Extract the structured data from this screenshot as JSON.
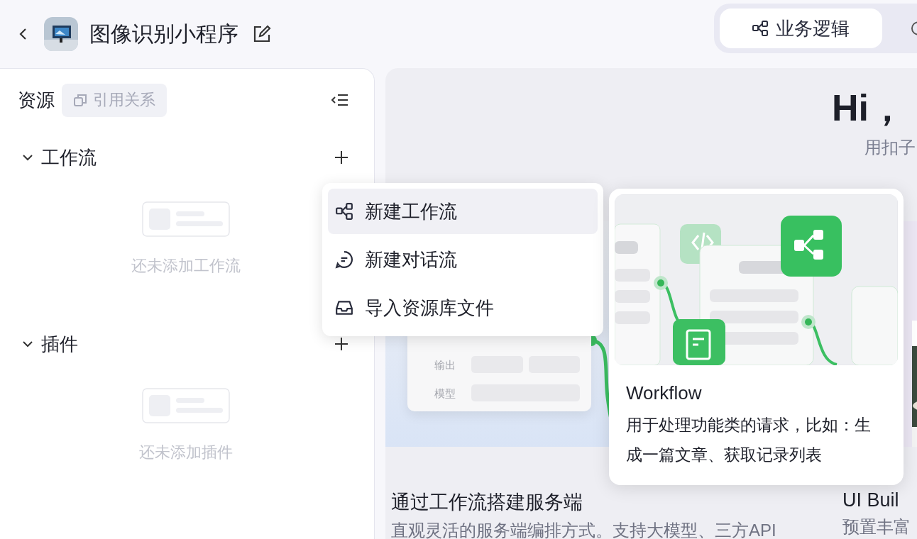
{
  "header": {
    "title": "图像识别小程序",
    "tabs": [
      {
        "label": "业务逻辑",
        "selected": true
      }
    ]
  },
  "resources": {
    "title": "资源",
    "reference_button": {
      "label": "引用关系",
      "disabled": true
    },
    "sections": [
      {
        "title": "工作流",
        "expanded": true,
        "empty_text": "还未添加工作流"
      },
      {
        "title": "插件",
        "expanded": true,
        "empty_text": "还未添加插件"
      }
    ]
  },
  "main": {
    "greeting": "Hi，",
    "subtitle": "用扣子",
    "cards": [
      {
        "title": "通过工作流搭建服务端",
        "description": "直观灵活的服务端编排方式。支持大模型、三方API",
        "labels": [
          "输出",
          "模型"
        ]
      },
      {
        "title": "UI Buil",
        "description": "预置丰富"
      }
    ]
  },
  "menu": {
    "items": [
      {
        "kind": "workflow",
        "label": "新建工作流",
        "selected": true
      },
      {
        "kind": "chat",
        "label": "新建对话流",
        "selected": false
      },
      {
        "kind": "import",
        "label": "导入资源库文件",
        "selected": false
      }
    ]
  },
  "preview": {
    "title": "Workflow",
    "description": "用于处理功能类的请求，比如：生成一篇文章、获取记录列表"
  }
}
